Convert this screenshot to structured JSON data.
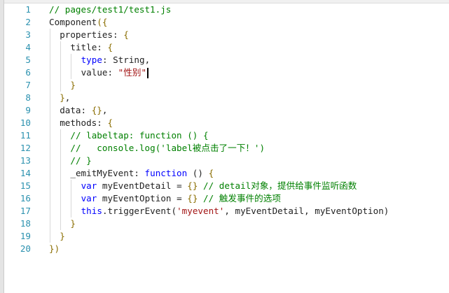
{
  "editor": {
    "lines": [
      {
        "n": "1",
        "indent": 0,
        "tokens": [
          [
            "// pages/test1/test1.js",
            "c"
          ]
        ]
      },
      {
        "n": "2",
        "indent": 0,
        "tokens": [
          [
            "Component",
            "t"
          ],
          [
            "({",
            "b"
          ]
        ]
      },
      {
        "n": "3",
        "indent": 1,
        "tokens": [
          [
            "properties: ",
            "t"
          ],
          [
            "{",
            "b"
          ]
        ]
      },
      {
        "n": "4",
        "indent": 2,
        "tokens": [
          [
            "title: ",
            "t"
          ],
          [
            "{",
            "b"
          ]
        ]
      },
      {
        "n": "5",
        "indent": 3,
        "tokens": [
          [
            "type",
            "k"
          ],
          [
            ": String,",
            "t"
          ]
        ]
      },
      {
        "n": "6",
        "indent": 3,
        "tokens": [
          [
            "value: ",
            "t"
          ],
          [
            "\"性别\"",
            "s"
          ]
        ],
        "cursor": true
      },
      {
        "n": "7",
        "indent": 2,
        "tokens": [
          [
            "}",
            "b"
          ]
        ]
      },
      {
        "n": "8",
        "indent": 1,
        "tokens": [
          [
            "}",
            "b"
          ],
          [
            ",",
            "t"
          ]
        ]
      },
      {
        "n": "9",
        "indent": 1,
        "tokens": [
          [
            "data: ",
            "t"
          ],
          [
            "{}",
            "b"
          ],
          [
            ",",
            "t"
          ]
        ]
      },
      {
        "n": "10",
        "indent": 1,
        "tokens": [
          [
            "methods: ",
            "t"
          ],
          [
            "{",
            "b"
          ]
        ]
      },
      {
        "n": "11",
        "indent": 2,
        "tokens": [
          [
            "// labeltap: function () {",
            "c"
          ]
        ]
      },
      {
        "n": "12",
        "indent": 2,
        "tokens": [
          [
            "//   console.log('label被点击了一下！')",
            "c"
          ]
        ]
      },
      {
        "n": "13",
        "indent": 2,
        "tokens": [
          [
            "// }",
            "c"
          ]
        ]
      },
      {
        "n": "14",
        "indent": 2,
        "tokens": [
          [
            "_emitMyEvent: ",
            "t"
          ],
          [
            "function",
            "k"
          ],
          [
            " () ",
            "t"
          ],
          [
            "{",
            "b"
          ]
        ]
      },
      {
        "n": "15",
        "indent": 3,
        "tokens": [
          [
            "var",
            "k"
          ],
          [
            " myEventDetail = ",
            "t"
          ],
          [
            "{}",
            "b"
          ],
          [
            " // detail对象，提供给事件监听函数",
            "c"
          ]
        ]
      },
      {
        "n": "16",
        "indent": 3,
        "tokens": [
          [
            "var",
            "k"
          ],
          [
            " myEventOption = ",
            "t"
          ],
          [
            "{}",
            "b"
          ],
          [
            " // 触发事件的选项",
            "c"
          ]
        ]
      },
      {
        "n": "17",
        "indent": 3,
        "tokens": [
          [
            "this",
            "k"
          ],
          [
            ".triggerEvent(",
            "t"
          ],
          [
            "'myevent'",
            "s"
          ],
          [
            ", myEventDetail, myEventOption)",
            "t"
          ]
        ]
      },
      {
        "n": "18",
        "indent": 2,
        "tokens": [
          [
            "}",
            "b"
          ]
        ]
      },
      {
        "n": "19",
        "indent": 1,
        "tokens": [
          [
            "}",
            "b"
          ]
        ]
      },
      {
        "n": "20",
        "indent": 0,
        "tokens": [
          [
            "})",
            "b"
          ]
        ]
      }
    ]
  }
}
